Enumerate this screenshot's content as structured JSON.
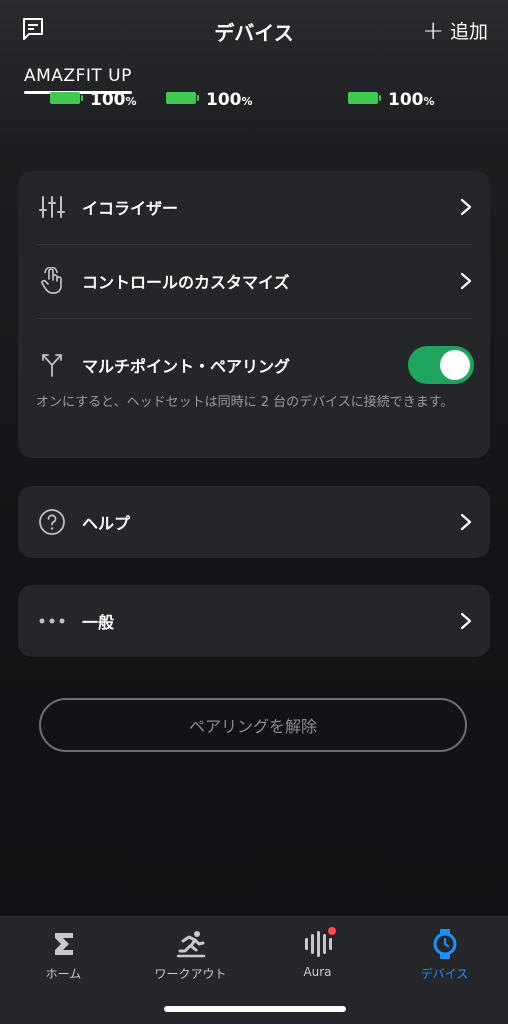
{
  "header": {
    "title": "デバイス",
    "add_label": "追加",
    "feedback_icon": "chat-square-icon",
    "plus_icon": "plus-icon"
  },
  "device": {
    "name": "AMAZFIT UP",
    "batteries": [
      {
        "value": "100",
        "unit": "%"
      },
      {
        "value": "100",
        "unit": "%"
      },
      {
        "value": "100",
        "unit": "%"
      }
    ]
  },
  "settings_card": {
    "equalizer_label": "イコライザー",
    "controls_label": "コントロールのカスタマイズ",
    "multipoint_label": "マルチポイント・ペアリング",
    "multipoint_enabled": true,
    "multipoint_description": "オンにすると、ヘッドセットは同時に 2 台のデバイスに接続できます。"
  },
  "help_card": {
    "label": "ヘルプ"
  },
  "general_card": {
    "label": "一般"
  },
  "unpair_label": "ペアリングを解除",
  "bottom_nav": [
    {
      "label": "ホーム",
      "icon": "sigma-icon",
      "active": false
    },
    {
      "label": "ワークアウト",
      "icon": "runner-icon",
      "active": false
    },
    {
      "label": "Aura",
      "icon": "aura-icon",
      "active": false,
      "badge": true
    },
    {
      "label": "デバイス",
      "icon": "watch-icon",
      "active": true
    }
  ],
  "colors": {
    "accent": "#1e8fff",
    "toggle_on": "#1ea45c",
    "battery": "#3fc950",
    "badge": "#ff4b4b"
  }
}
